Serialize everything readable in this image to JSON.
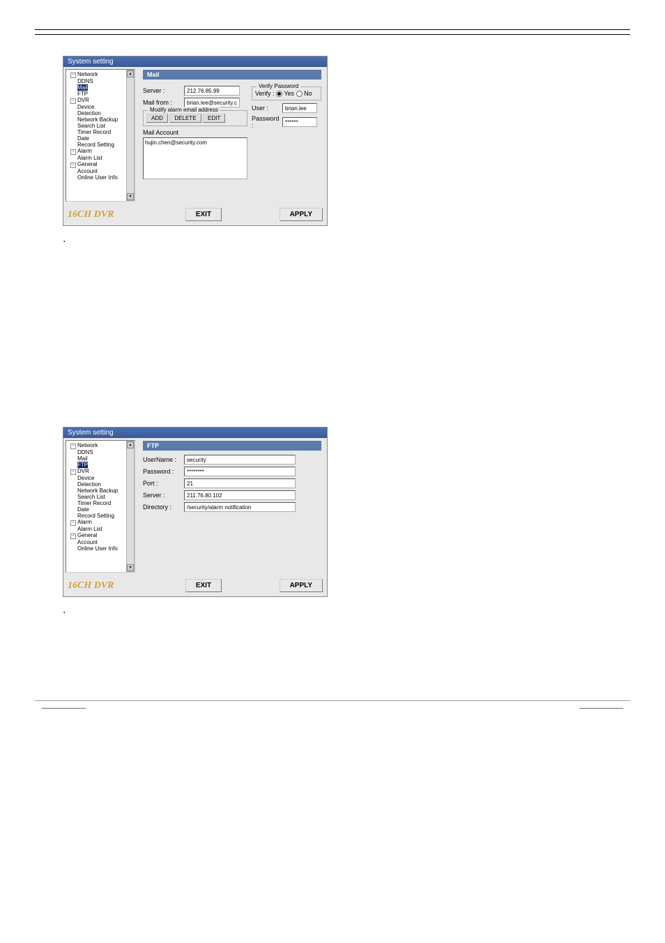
{
  "dialog_title": "System setting",
  "tree": {
    "network": "Network",
    "ddns": "DDNS",
    "mail": "Mail",
    "ftp": "FTP",
    "dvr": "DVR",
    "device": "Device",
    "detection": "Detection",
    "network_backup": "Network Backup",
    "search_list": "Search List",
    "timer_record": "Timer Record",
    "date": "Date",
    "record_setting": "Record Setting",
    "alarm": "Alarm",
    "alarm_list": "Alarm List",
    "general": "General",
    "account": "Account",
    "online_user_info": "Online User Info"
  },
  "mail_panel": {
    "title": "Mail",
    "server_label": "Server :",
    "server_value": "212.76.85.99",
    "mail_from_label": "Mail from :",
    "mail_from_value": "brian.lee@security.co",
    "modify_legend": "Modify alarm email address",
    "add_btn": "ADD",
    "delete_btn": "DELETE",
    "edit_btn": "EDIT",
    "mail_account_label": "Mail Account",
    "mail_account_entry": "hujin.chen@security.com",
    "verify_legend": "Verify Password",
    "verify_label": "Verify :",
    "yes": "Yes",
    "no": "No",
    "user_label": "User :",
    "user_value": "brian.lee",
    "password_label": "Password :",
    "password_value": "******"
  },
  "ftp_panel": {
    "title": "FTP",
    "username_label": "UserName :",
    "username_value": "security",
    "password_label": "Password :",
    "password_value": "********",
    "port_label": "Port :",
    "port_value": "21",
    "server_label": "Server  :",
    "server_value": "211.76.80.102",
    "directory_label": "Directory :",
    "directory_value": "/security/alarm notification"
  },
  "brand": "16CH DVR",
  "exit_btn": "EXIT",
  "apply_btn": "APPLY",
  "dot": "."
}
